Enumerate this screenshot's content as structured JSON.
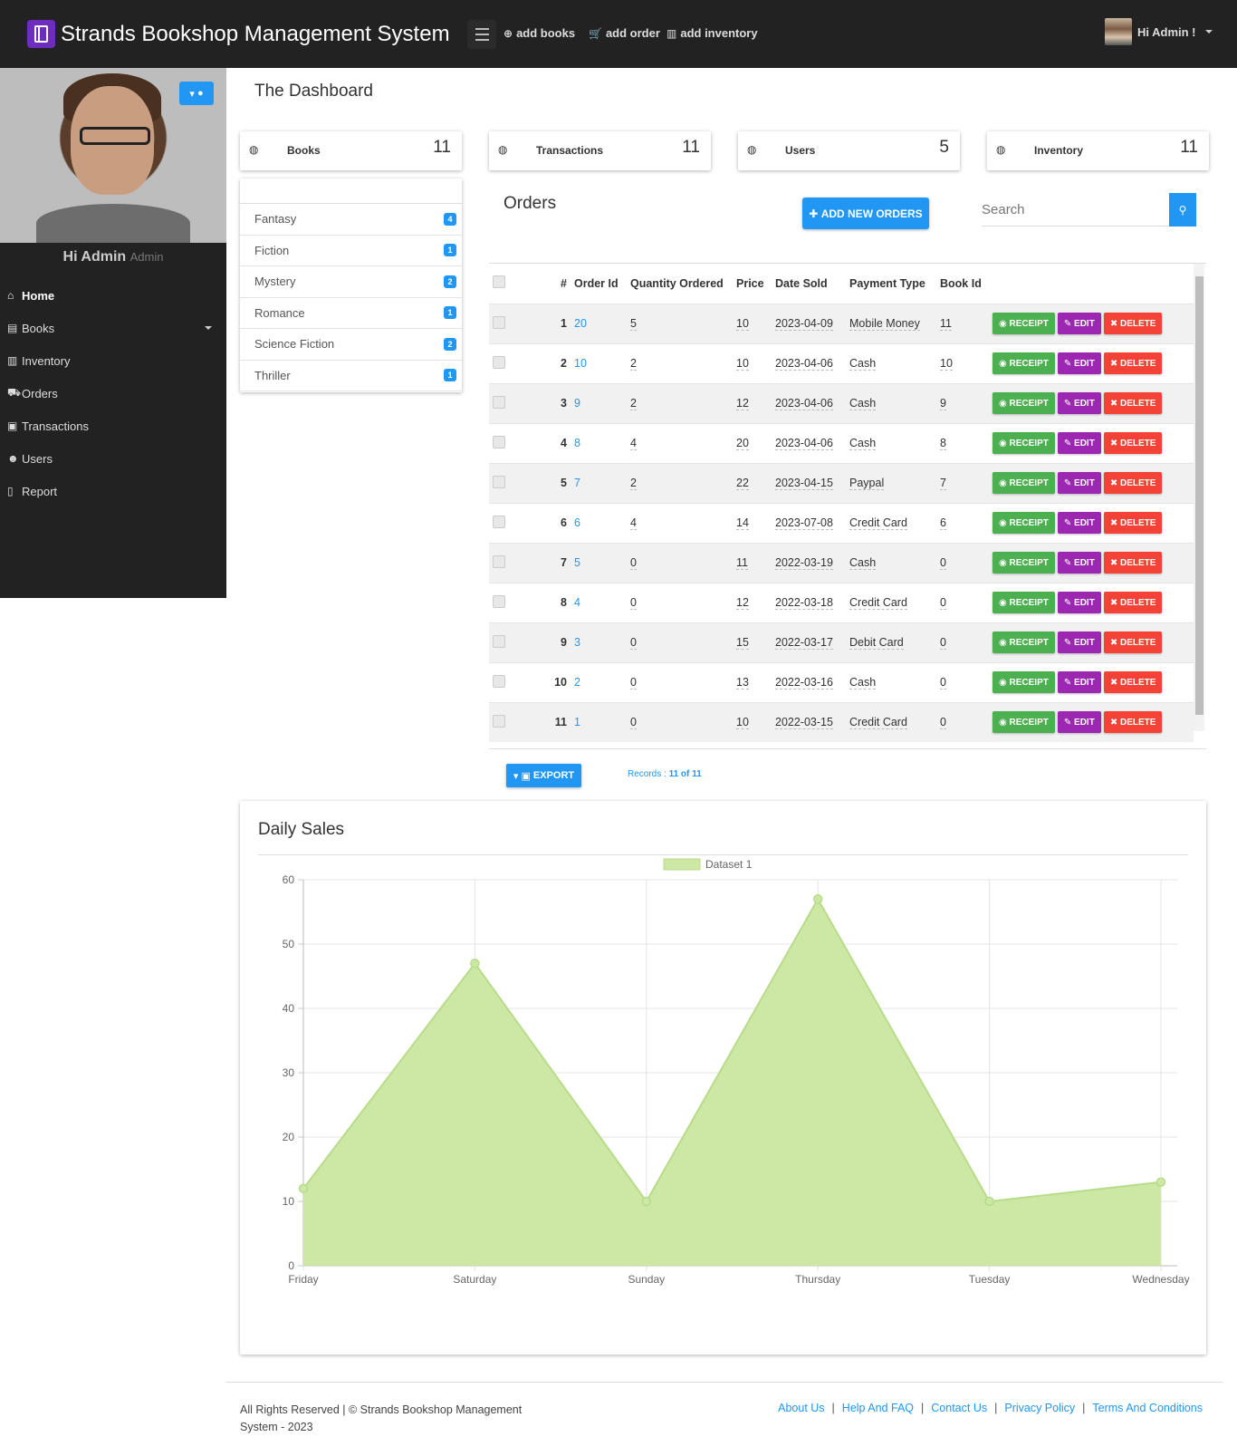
{
  "app": {
    "title": "Strands Bookshop Management System",
    "greeting": "Hi Admin !"
  },
  "topnav": [
    {
      "icon": "plus-circle-icon",
      "glyph": "⊕",
      "label": "add books"
    },
    {
      "icon": "cart-icon",
      "glyph": "🛒",
      "label": "add order"
    },
    {
      "icon": "bar-chart-icon",
      "glyph": "▥",
      "label": "add inventory"
    }
  ],
  "sidebar": {
    "name": "Hi Admin",
    "role": "Admin",
    "items": [
      {
        "icon": "home-icon",
        "glyph": "⌂",
        "label": "Home"
      },
      {
        "icon": "book-icon",
        "glyph": "▤",
        "label": "Books"
      },
      {
        "icon": "bar-chart-icon",
        "glyph": "▥",
        "label": "Inventory"
      },
      {
        "icon": "cart-icon",
        "glyph": "⛟",
        "label": "Orders"
      },
      {
        "icon": "money-icon",
        "glyph": "▣",
        "label": "Transactions"
      },
      {
        "icon": "users-icon",
        "glyph": "☻",
        "label": "Users"
      },
      {
        "icon": "file-icon",
        "glyph": "▯",
        "label": "Report"
      }
    ]
  },
  "page": {
    "title": "The Dashboard"
  },
  "stats": [
    {
      "label": "Books",
      "value": "11"
    },
    {
      "label": "Transactions",
      "value": "11"
    },
    {
      "label": "Users",
      "value": "5"
    },
    {
      "label": "Inventory",
      "value": "11"
    }
  ],
  "categories": [
    {
      "name": "Fantasy",
      "count": "4"
    },
    {
      "name": "Fiction",
      "count": "1"
    },
    {
      "name": "Mystery",
      "count": "2"
    },
    {
      "name": "Romance",
      "count": "1"
    },
    {
      "name": "Science Fiction",
      "count": "2"
    },
    {
      "name": "Thriller",
      "count": "1"
    }
  ],
  "orders": {
    "title": "Orders",
    "add_label": "ADD NEW ORDERS",
    "search_placeholder": "Search",
    "columns": [
      "#",
      "Order Id",
      "Quantity Ordered",
      "Price",
      "Date Sold",
      "Payment Type",
      "Book Id"
    ],
    "actions": {
      "receipt": "RECEIPT",
      "edit": "EDIT",
      "delete": "DELETE"
    },
    "rows": [
      {
        "n": "1",
        "order_id": "20",
        "qty": "5",
        "price": "10",
        "date": "2023-04-09",
        "payment": "Mobile Money",
        "book_id": "11"
      },
      {
        "n": "2",
        "order_id": "10",
        "qty": "2",
        "price": "10",
        "date": "2023-04-06",
        "payment": "Cash",
        "book_id": "10"
      },
      {
        "n": "3",
        "order_id": "9",
        "qty": "2",
        "price": "12",
        "date": "2023-04-06",
        "payment": "Cash",
        "book_id": "9"
      },
      {
        "n": "4",
        "order_id": "8",
        "qty": "4",
        "price": "20",
        "date": "2023-04-06",
        "payment": "Cash",
        "book_id": "8"
      },
      {
        "n": "5",
        "order_id": "7",
        "qty": "2",
        "price": "22",
        "date": "2023-04-15",
        "payment": "Paypal",
        "book_id": "7"
      },
      {
        "n": "6",
        "order_id": "6",
        "qty": "4",
        "price": "14",
        "date": "2023-07-08",
        "payment": "Credit Card",
        "book_id": "6"
      },
      {
        "n": "7",
        "order_id": "5",
        "qty": "0",
        "price": "11",
        "date": "2022-03-19",
        "payment": "Cash",
        "book_id": "0"
      },
      {
        "n": "8",
        "order_id": "4",
        "qty": "0",
        "price": "12",
        "date": "2022-03-18",
        "payment": "Credit Card",
        "book_id": "0"
      },
      {
        "n": "9",
        "order_id": "3",
        "qty": "0",
        "price": "15",
        "date": "2022-03-17",
        "payment": "Debit Card",
        "book_id": "0"
      },
      {
        "n": "10",
        "order_id": "2",
        "qty": "0",
        "price": "13",
        "date": "2022-03-16",
        "payment": "Cash",
        "book_id": "0"
      },
      {
        "n": "11",
        "order_id": "1",
        "qty": "0",
        "price": "10",
        "date": "2022-03-15",
        "payment": "Credit Card",
        "book_id": "0"
      }
    ],
    "export_label": "EXPORT",
    "records_label": "Records :",
    "records_value": "11 of 11"
  },
  "sales": {
    "title": "Daily Sales"
  },
  "chart_data": {
    "type": "area",
    "categories": [
      "Friday",
      "Saturday",
      "Sunday",
      "Thursday",
      "Tuesday",
      "Wednesday"
    ],
    "series": [
      {
        "name": "Dataset 1",
        "values": [
          12,
          47,
          10,
          57,
          10,
          13
        ]
      }
    ],
    "ylim": [
      0,
      60
    ],
    "yticks": [
      0,
      10,
      20,
      30,
      40,
      50,
      60
    ],
    "legend": "top",
    "grid": true,
    "fill_color": "#cde8a4",
    "line_color": "#b7dc8a"
  },
  "footer": {
    "copyright": "All Rights Reserved | © Strands Bookshop Management System - 2023",
    "links": [
      "About Us",
      "Help And FAQ",
      "Contact Us",
      "Privacy Policy",
      "Terms And Conditions"
    ]
  },
  "colors": {
    "primary": "#2196f3",
    "success": "#4caf50",
    "purple": "#9c27b0",
    "danger": "#f44336",
    "dark": "#222222"
  }
}
